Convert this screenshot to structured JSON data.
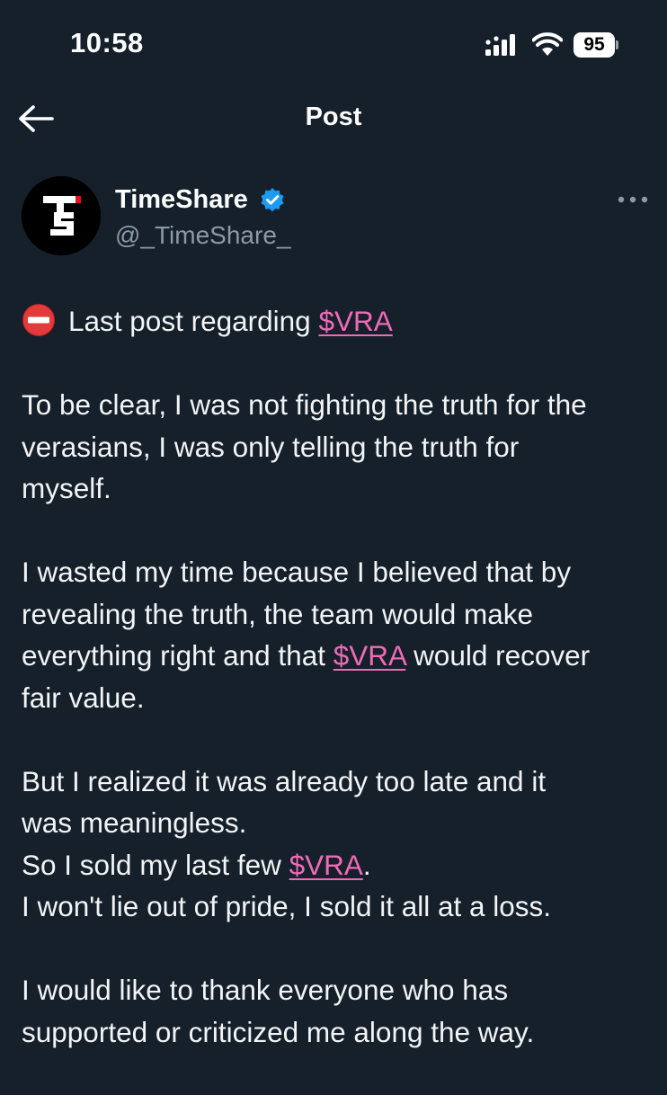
{
  "status_bar": {
    "time": "10:58",
    "battery": "95"
  },
  "header": {
    "title": "Post"
  },
  "author": {
    "display_name": "TimeShare",
    "handle": "@_TimeShare_"
  },
  "post": {
    "intro": "Last post regarding",
    "cashtag": "$VRA",
    "p1": [
      "To be clear, I was not fighting the truth for the",
      "verasians, I was only telling the truth for",
      "myself."
    ],
    "p2": {
      "line1": "I wasted my time because I believed that by",
      "line2": "revealing the truth, the team would make",
      "line3_before": "everything right and that",
      "line3_after": "would recover",
      "line4": "fair value."
    },
    "p3": {
      "line1": "But I realized it was already too late and it",
      "line2": "was meaningless.",
      "line3_before": "So I sold my last few",
      "line3_after": ".",
      "line4": "I won't lie out of pride, I sold it all at a loss."
    },
    "p4": [
      "I would like to thank everyone who has",
      "supported or criticized me along the way."
    ]
  },
  "icons": {
    "back": "arrow-left-icon",
    "more": "more-horizontal-icon",
    "verified": "verified-badge-icon",
    "stop": "no-entry-emoji"
  },
  "colors": {
    "background": "#15202b",
    "cashtag": "#f06ab8",
    "verified": "#1d9bf0",
    "secondary_text": "#8b98a5"
  }
}
